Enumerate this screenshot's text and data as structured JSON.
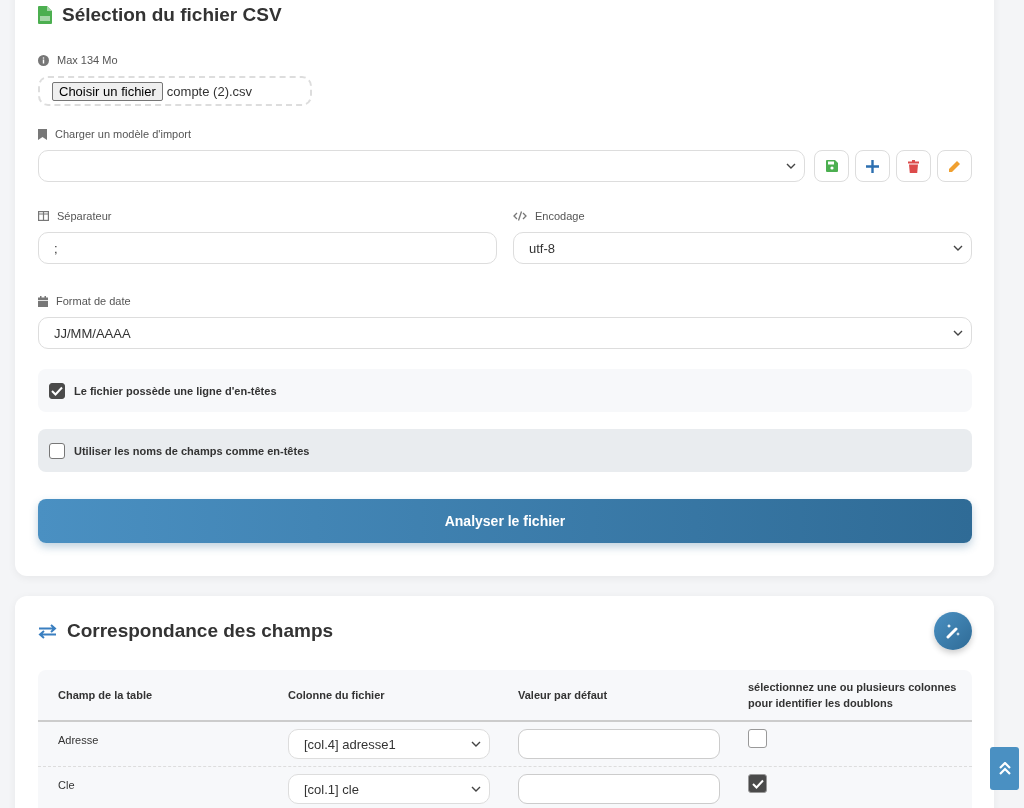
{
  "file_section": {
    "title": "Sélection du fichier CSV",
    "max_size": "Max 134 Mo",
    "file_button": "Choisir un fichier",
    "file_name": "compte (2).csv",
    "template_label": "Charger un modèle d'import",
    "separator_label": "Séparateur",
    "separator_value": ";",
    "encoding_label": "Encodage",
    "encoding_value": "utf-8",
    "date_label": "Format de date",
    "date_value": "JJ/MM/AAAA",
    "options": [
      {
        "label": "Le fichier possède une ligne d'en-têtes",
        "checked": true,
        "hovered": false
      },
      {
        "label": "Utiliser les noms de champs comme en-têtes",
        "checked": false,
        "hovered": true
      }
    ],
    "analyze_button": "Analyser le fichier"
  },
  "mapping_section": {
    "title": "Correspondance des champs",
    "table": {
      "columns": [
        "Champ de la table",
        "Colonne du fichier",
        "Valeur par défaut",
        "sélectionnez une ou plusieurs colonnes pour identifier les doublons"
      ],
      "rows": [
        {
          "field": "Adresse",
          "column": "[col.4] adresse1",
          "checked": false
        },
        {
          "field": "Cle",
          "column": "[col.1] cle",
          "checked": true
        }
      ]
    }
  }
}
